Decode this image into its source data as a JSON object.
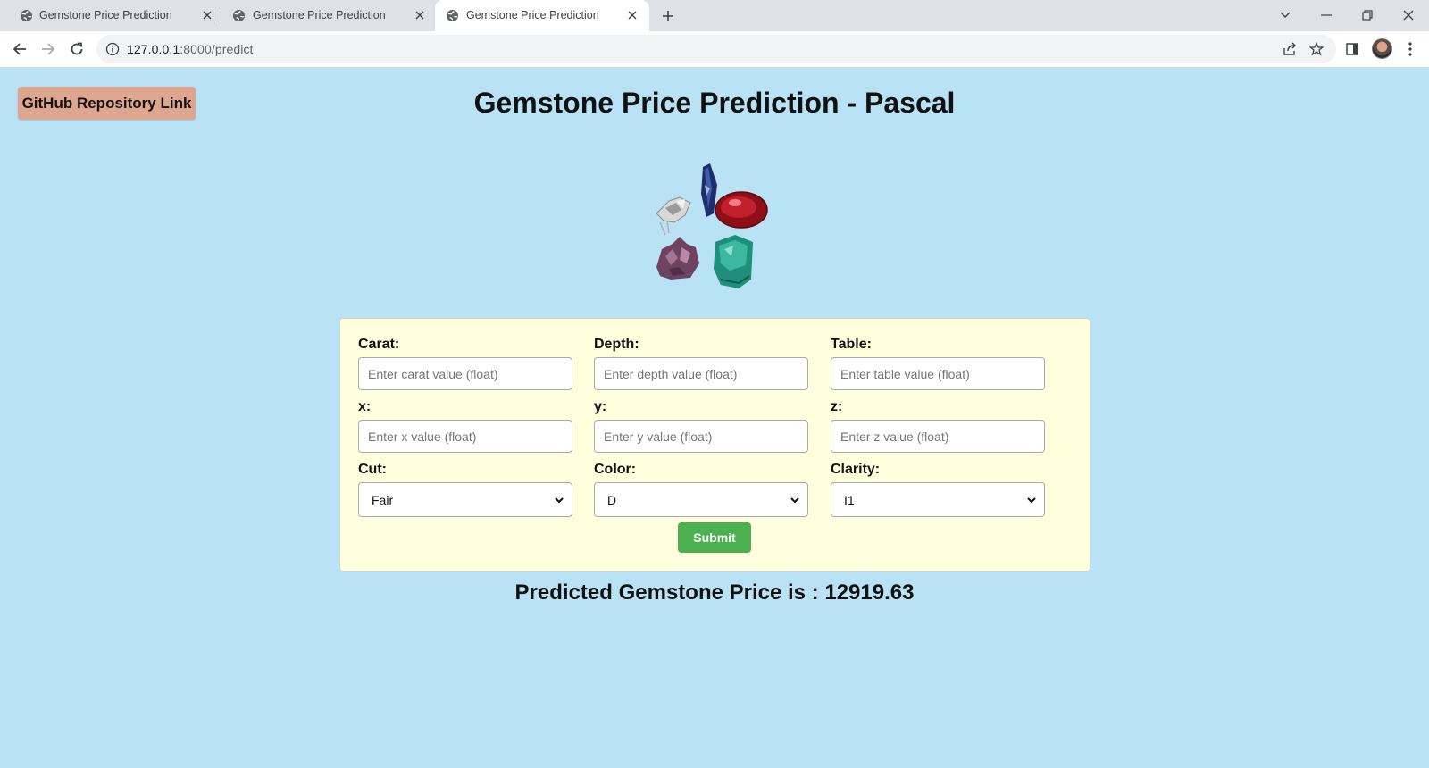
{
  "browser": {
    "tabs": [
      {
        "title": "Gemstone Price Prediction",
        "active": false
      },
      {
        "title": "Gemstone Price Prediction",
        "active": false
      },
      {
        "title": "Gemstone Price Prediction",
        "active": true
      }
    ],
    "url_host": "127.0.0.1",
    "url_path": ":8000/predict"
  },
  "page": {
    "github_button": "GitHub Repository Link",
    "title": "Gemstone Price Prediction - Pascal",
    "image_alt": "gemstones"
  },
  "form": {
    "fields": [
      {
        "label": "Carat:",
        "placeholder": "Enter carat value (float)"
      },
      {
        "label": "Depth:",
        "placeholder": "Enter depth value (float)"
      },
      {
        "label": "Table:",
        "placeholder": "Enter table value (float)"
      },
      {
        "label": "x:",
        "placeholder": "Enter x value (float)"
      },
      {
        "label": "y:",
        "placeholder": "Enter y value (float)"
      },
      {
        "label": "z:",
        "placeholder": "Enter z value (float)"
      }
    ],
    "selects": [
      {
        "label": "Cut:",
        "value": "Fair"
      },
      {
        "label": "Color:",
        "value": "D"
      },
      {
        "label": "Clarity:",
        "value": "I1"
      }
    ],
    "submit": "Submit"
  },
  "result": {
    "text": "Predicted Gemstone Price is : 12919.63"
  },
  "colors": {
    "page_bg": "#bae2f5",
    "card_bg": "#fffedd",
    "github_button": "#dea68f",
    "submit_button": "#4caf50"
  }
}
